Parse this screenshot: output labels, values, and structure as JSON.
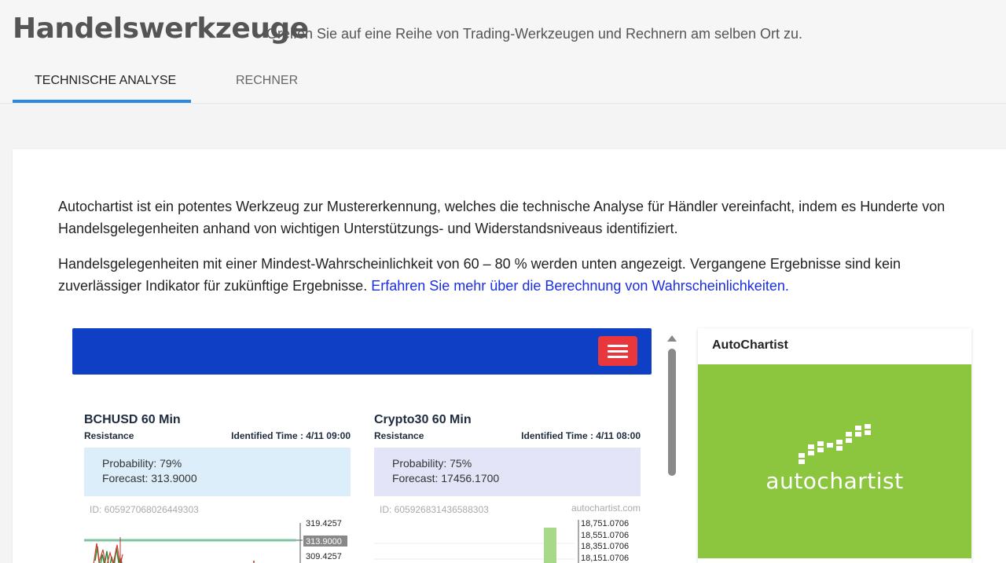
{
  "header": {
    "title": "Handelswerkzeuge",
    "subtitle": "Greifen Sie auf eine Reihe von Trading-Werkzeugen und Rechnern am selben Ort zu.",
    "tabs": [
      {
        "label": "TECHNISCHE ANALYSE",
        "active": true
      },
      {
        "label": "RECHNER",
        "active": false
      }
    ],
    "accent_color": "#2b8ae0"
  },
  "intro": {
    "paragraph1": "Autochartist ist ein potentes Werkzeug zur Mustererkennung, welches die technische Analyse für Händler vereinfacht, indem es Hunderte von Handelsgelegenheiten anhand von wichtigen Unterstützungs- und Widerstandsniveaus identifiziert.",
    "paragraph2": "Handelsgelegenheiten mit einer Mindest-Wahrscheinlichkeit von 60 – 80 % werden unten angezeigt. Vergangene Ergebnisse sind kein zuverlässiger Indikator für zukünftige Ergebnisse.",
    "link_text": "Erfahren Sie mehr über die Berechnung von Wahrscheinlichkeiten."
  },
  "widget": {
    "bar_color": "#0f3fc5",
    "menu_icon": "hamburger-menu-icon",
    "cards": [
      {
        "symbol": "BCHUSD 60 Min",
        "type": "Resistance",
        "time": "Identified Time : 4/11 09:00",
        "probability": "Probability: 79%",
        "forecast": "Forecast: 313.9000",
        "id": "ID: 605927068026449303",
        "brand": "",
        "price_labels": [
          "319.4257",
          "313.9000",
          "309.4257"
        ]
      },
      {
        "symbol": "Crypto30 60 Min",
        "type": "Resistance",
        "time": "Identified Time : 4/11 08:00",
        "probability": "Probability: 75%",
        "forecast": "Forecast: 17456.1700",
        "id": "ID: 605926831436588303",
        "brand": "autochartist.com",
        "price_labels": [
          "18,751.0706",
          "18,551.0706",
          "18,351.0706",
          "18,151.0706"
        ]
      }
    ]
  },
  "sidebar": {
    "title": "AutoChartist",
    "logo_text": "autochartist",
    "logo_bg": "#8cc63f"
  }
}
